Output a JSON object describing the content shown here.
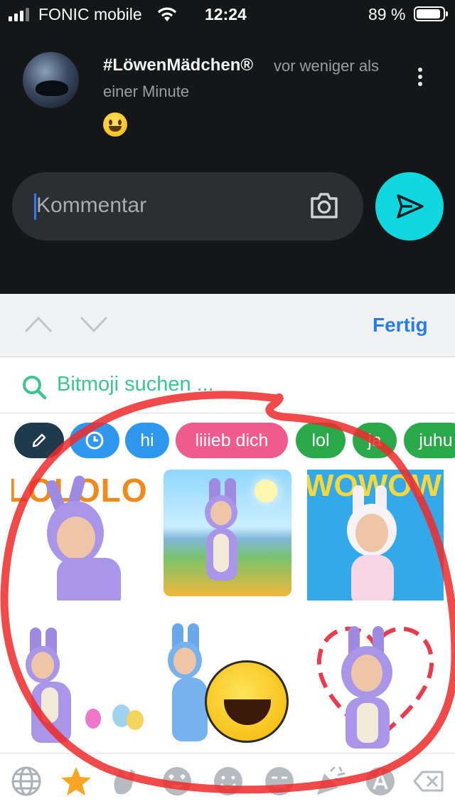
{
  "status_bar": {
    "carrier": "FONIC mobile",
    "time": "12:24",
    "battery": "89 %",
    "signal_bars": 3
  },
  "comment": {
    "author": "#LöwenMädchen®",
    "time_line1": "vor weniger als",
    "time_line2": "einer Minute",
    "emoji": "smiley-emoji"
  },
  "composer": {
    "placeholder": "Kommentar",
    "send_color": "#10d6e0"
  },
  "keyboard_bar": {
    "done_label": "Fertig"
  },
  "bitmoji": {
    "search_placeholder": "Bitmoji suchen ...",
    "chips": [
      "hi",
      "liiieb dich",
      "lol",
      "ja",
      "juhu"
    ],
    "tile_texts": [
      "LOLOLO",
      "WOWOW"
    ]
  },
  "colors": {
    "accent_green": "#3dc48f",
    "chip_blue": "#2f98ee",
    "chip_pink": "#ef5b8c",
    "chip_green": "#2aa84a",
    "annotation_red": "#ee2a2a"
  },
  "bottom_icons": [
    "globe-icon",
    "star-icon",
    "wave-icon",
    "heart-eyes-icon",
    "smile-icon",
    "neutral-face-icon",
    "party-icon",
    "text-a-icon",
    "backspace-icon"
  ]
}
